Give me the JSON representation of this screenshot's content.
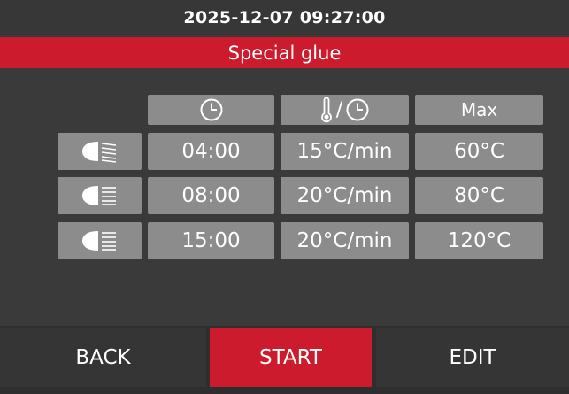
{
  "header": {
    "datetime": "2025-12-07 09:27:00"
  },
  "program": {
    "title": "Special glue"
  },
  "table": {
    "headers": {
      "time_icon": "clock-icon",
      "rate_icon": "thermometer-per-clock-icon",
      "max_label": "Max",
      "rate_separator": "/"
    },
    "rows": [
      {
        "mode_icon": "lamp-beam-icon",
        "time": "04:00",
        "rate": "15°C/min",
        "max": "60°C"
      },
      {
        "mode_icon": "lamp-beam-icon",
        "time": "08:00",
        "rate": "20°C/min",
        "max": "80°C"
      },
      {
        "mode_icon": "lamp-beam-icon",
        "time": "15:00",
        "rate": "20°C/min",
        "max": "120°C"
      }
    ]
  },
  "footer": {
    "back_label": "BACK",
    "start_label": "START",
    "edit_label": "EDIT"
  },
  "colors": {
    "accent": "#cc1b2c",
    "background": "#3a3a3a",
    "cell": "#8c8c8c"
  }
}
